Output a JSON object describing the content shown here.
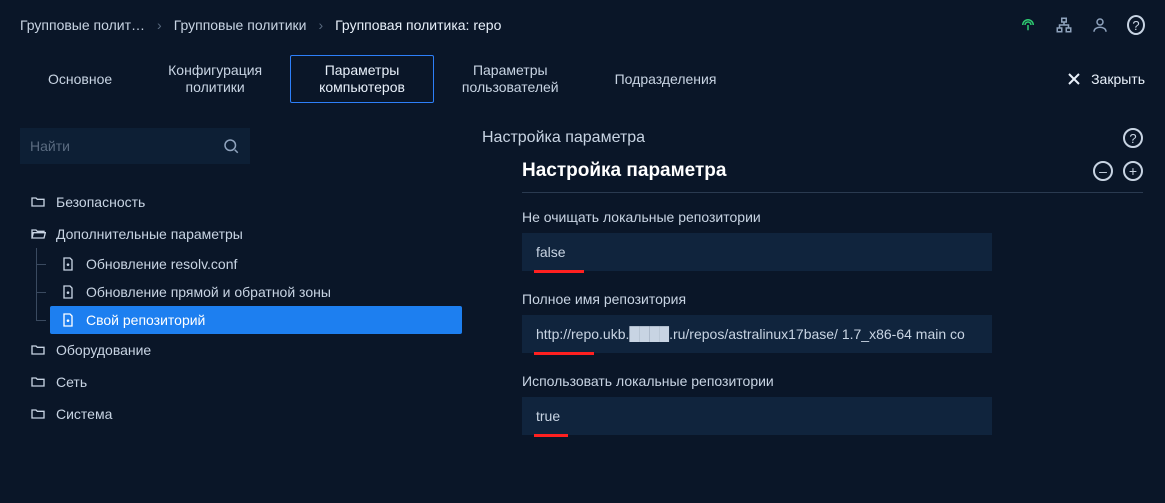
{
  "breadcrumb": [
    "Групповые полит…",
    "Групповые политики",
    "Групповая политика: repo"
  ],
  "tabs": {
    "main": "Основное",
    "config": "Конфигурация\nполитики",
    "comp_params": "Параметры\nкомпьютеров",
    "user_params": "Параметры\nпользователей",
    "units": "Подразделения"
  },
  "close_label": "Закрыть",
  "search": {
    "placeholder": "Найти"
  },
  "tree": {
    "security": "Безопасность",
    "extra": "Дополнительные параметры",
    "resolv": "Обновление resolv.conf",
    "zone": "Обновление прямой и обратной зоны",
    "ownrepo": "Свой репозиторий",
    "hardware": "Оборудование",
    "network": "Сеть",
    "system": "Система"
  },
  "panel": {
    "title": "Настройка параметра",
    "card_title": "Настройка параметра",
    "f1_label": "Не очищать локальные репозитории",
    "f1_value": "false",
    "f2_label": "Полное имя репозитория",
    "f2_value": "http://repo.ukb.████.ru/repos/astralinux17base/ 1.7_x86-64 main co",
    "f3_label": "Использовать локальные репозитории",
    "f3_value": "true"
  }
}
